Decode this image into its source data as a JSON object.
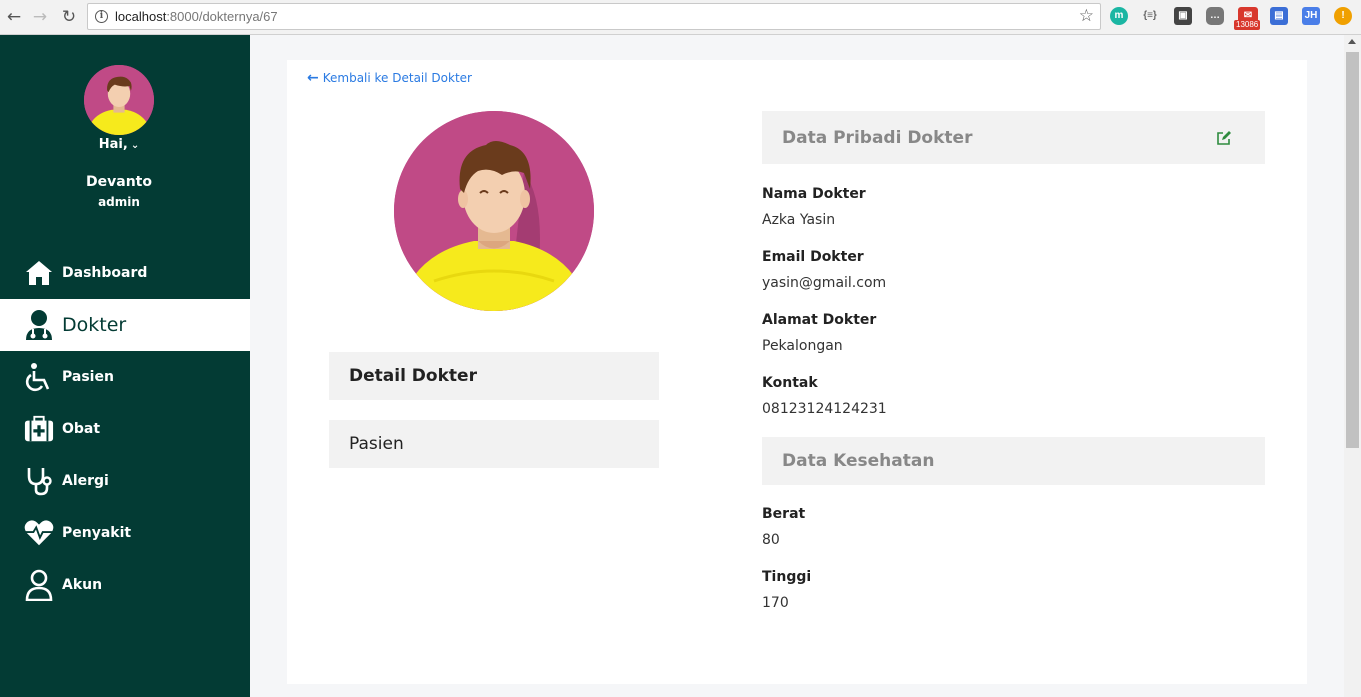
{
  "browser": {
    "url_host": "localhost",
    "url_path": ":8000/dokternya/67",
    "ext_badge": "13086",
    "ext_m": "m",
    "ext_braces": "{≡}",
    "ext_jh": "JH",
    "ext_warn": "!"
  },
  "sidebar": {
    "greeting": "Hai,",
    "user_name": "Devanto",
    "user_role": "admin",
    "items": [
      {
        "label": "Dashboard",
        "icon": "home-icon"
      },
      {
        "label": "Dokter",
        "icon": "doctor-icon"
      },
      {
        "label": "Pasien",
        "icon": "wheelchair-icon"
      },
      {
        "label": "Obat",
        "icon": "medkit-icon"
      },
      {
        "label": "Alergi",
        "icon": "stethoscope-icon"
      },
      {
        "label": "Penyakit",
        "icon": "heartbeat-icon"
      },
      {
        "label": "Akun",
        "icon": "user-icon"
      }
    ],
    "colors": {
      "bg": "#033b34",
      "active_bg": "#ffffff"
    }
  },
  "main": {
    "back_link": "Kembali ke Detail Dokter",
    "tabs": [
      "Detail Dokter",
      "Pasien"
    ],
    "pribadi": {
      "title": "Data Pribadi Dokter",
      "fields": [
        {
          "label": "Nama Dokter",
          "value": "Azka Yasin"
        },
        {
          "label": "Email Dokter",
          "value": "yasin@gmail.com"
        },
        {
          "label": "Alamat Dokter",
          "value": "Pekalongan"
        },
        {
          "label": "Kontak",
          "value": "08123124124231"
        }
      ]
    },
    "kesehatan": {
      "title": "Data Kesehatan",
      "fields": [
        {
          "label": "Berat",
          "value": "80"
        },
        {
          "label": "Tinggi",
          "value": "170"
        }
      ]
    }
  }
}
